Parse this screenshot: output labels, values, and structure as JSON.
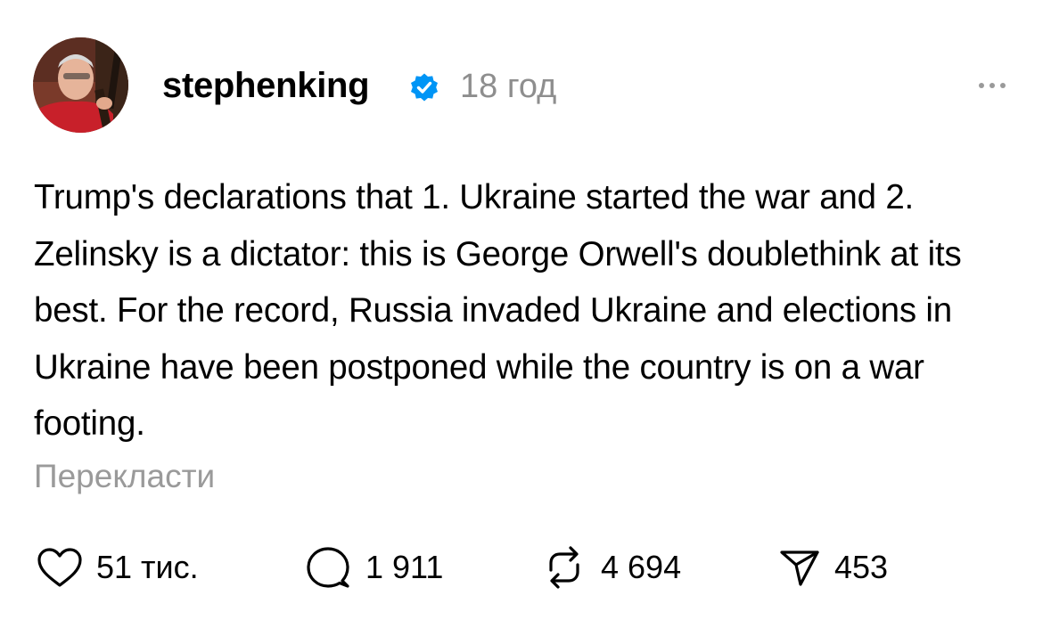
{
  "post": {
    "username": "stephenking",
    "time": "18 год",
    "text": "Trump's declarations that 1. Ukraine started the war and 2. Zelinsky is a dictator: this is George Orwell's doublethink at its best. For the record, Russia invaded Ukraine and elections in Ukraine have been postponed while the country is on a war footing.",
    "translate_label": "Перекласти",
    "verified_icon": "verified-badge-icon",
    "accent_color": "#0095f6"
  },
  "actions": {
    "likes": "51 тис.",
    "replies": "1 911",
    "reposts": "4 694",
    "shares": "453"
  }
}
